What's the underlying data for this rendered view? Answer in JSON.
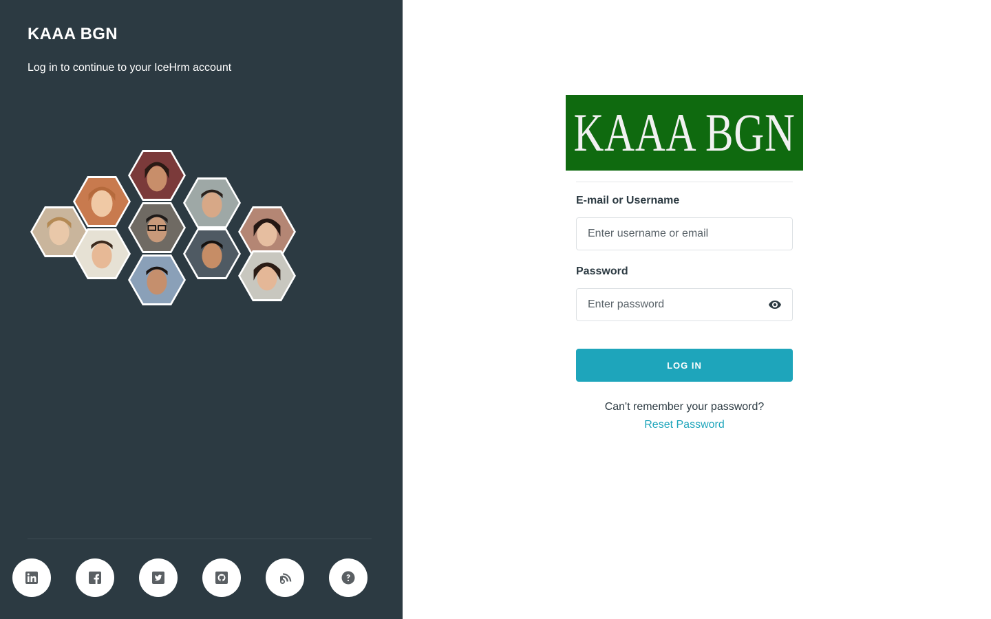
{
  "brand": {
    "name": "KAAA BGN",
    "tagline": "Log in to continue to your IceHrm account",
    "logo_text": "KAAA BGN"
  },
  "illustration": {
    "icon": "team-faces-honeycomb"
  },
  "form": {
    "username_label": "E-mail or Username",
    "username_placeholder": "Enter username or email",
    "username_value": "",
    "password_label": "Password",
    "password_placeholder": "Enter password",
    "password_value": "",
    "show_password_icon": "eye-icon",
    "login_label": "LOG IN",
    "forgot_text": "Can't remember your password?",
    "reset_link": "Reset Password"
  },
  "social": [
    {
      "icon": "linkedin-icon"
    },
    {
      "icon": "facebook-icon"
    },
    {
      "icon": "twitter-icon"
    },
    {
      "icon": "github-icon"
    },
    {
      "icon": "blog-icon"
    },
    {
      "icon": "help-icon"
    }
  ],
  "colors": {
    "panel_bg": "#2c3a42",
    "accent": "#1ea5bb",
    "logo_bg": "#0f6a0f",
    "text_dark": "#2c3a42"
  }
}
